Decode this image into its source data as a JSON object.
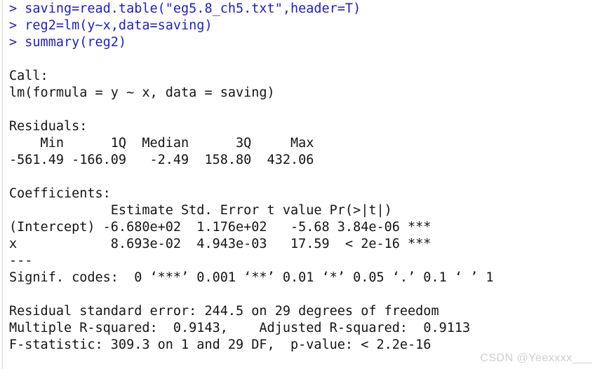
{
  "console": {
    "prompt_symbol": ">",
    "colors": {
      "background": "#ffffff",
      "output_text": "#141414",
      "command_text": "#1f20c4",
      "gutter_rule": "#d2d2d2",
      "watermark": "#cfcfcf"
    },
    "commands": [
      "> saving=read.table(\"eg5.8_ch5.txt\",header=T)",
      "> reg2=lm(y~x,data=saving)",
      "> summary(reg2)"
    ],
    "output": {
      "call_heading": "Call:",
      "call_formula": "lm(formula = y ~ x, data = saving)",
      "residuals_heading": "Residuals:",
      "residuals_header": "    Min      1Q  Median      3Q     Max ",
      "residuals_values": "-561.49 -166.09   -2.49  158.80  432.06 ",
      "coefficients_heading": "Coefficients:",
      "coefficients_header": "             Estimate Std. Error t value Pr(>|t|)    ",
      "coefficients_intercept": "(Intercept) -6.680e+02  1.176e+02   -5.68 3.84e-06 ***",
      "coefficients_x": "x            8.693e-02  4.943e-03   17.59  < 2e-16 ***",
      "signif_separator": "---",
      "signif_codes": "Signif. codes:  0 ‘***’ 0.001 ‘**’ 0.01 ‘*’ 0.05 ‘.’ 0.1 ‘ ’ 1",
      "residual_standard_error": "Residual standard error: 244.5 on 29 degrees of freedom",
      "r_squared_line": "Multiple R-squared:  0.9143,\tAdjusted R-squared:  0.9113 ",
      "f_statistic_line": "F-statistic: 309.3 on 1 and 29 DF,  p-value: < 2.2e-16"
    },
    "model_summary": {
      "call": "lm(formula = y ~ x, data = saving)",
      "residuals": {
        "min": "-561.49",
        "q1": "-166.09",
        "median": "-2.49",
        "q3": "158.80",
        "max": "432.06"
      },
      "coefficients": {
        "columns": [
          "Estimate",
          "Std. Error",
          "t value",
          "Pr(>|t|)",
          ""
        ],
        "rows": [
          {
            "term": "(Intercept)",
            "estimate": "-6.680e+02",
            "std_error": "1.176e+02",
            "t_value": "-5.68",
            "p_value": "3.84e-06",
            "signif": "***"
          },
          {
            "term": "x",
            "estimate": "8.693e-02",
            "std_error": "4.943e-03",
            "t_value": "17.59",
            "p_value": "< 2e-16",
            "signif": "***"
          }
        ]
      },
      "residual_standard_error": "244.5",
      "residual_degrees_of_freedom": "29",
      "multiple_r_squared": "0.9143",
      "adjusted_r_squared": "0.9113",
      "f_statistic": "309.3",
      "f_numerator_df": "1",
      "f_denominator_df": "29",
      "p_value": "< 2.2e-16"
    }
  },
  "watermark": {
    "text": "CSDN @Yeexxxx___"
  }
}
